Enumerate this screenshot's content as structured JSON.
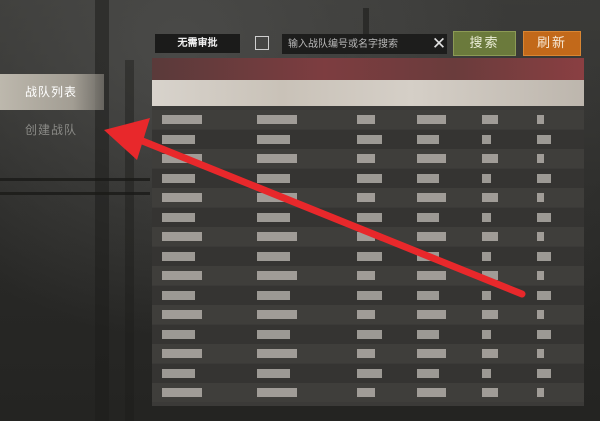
{
  "sidebar": {
    "items": [
      {
        "label": "战队列表",
        "active": true
      },
      {
        "label": "创建战队",
        "active": false
      }
    ]
  },
  "toolbar": {
    "filter_label": "无需审批",
    "filter_checked": false,
    "search_placeholder": "输入战队编号或名字搜索",
    "search_value": "",
    "clear_icon": "close-icon",
    "search_button": "搜索",
    "refresh_button": "刷新"
  },
  "colors": {
    "search_button": "#6b7a3c",
    "refresh_button": "#c2691a",
    "active_tab": "#bdb8ad",
    "annotation_arrow": "#e8282b"
  },
  "table": {
    "row_count": 15,
    "content": "pixelated"
  }
}
